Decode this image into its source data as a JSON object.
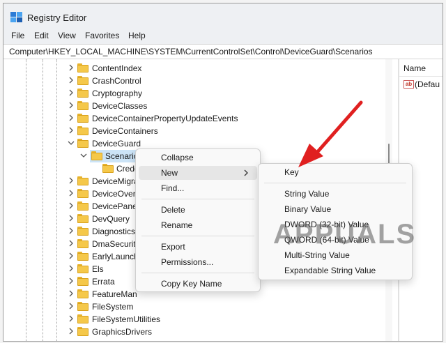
{
  "window": {
    "title": "Registry Editor"
  },
  "menubar": {
    "items": [
      "File",
      "Edit",
      "View",
      "Favorites",
      "Help"
    ]
  },
  "address": {
    "path": "Computer\\HKEY_LOCAL_MACHINE\\SYSTEM\\CurrentControlSet\\Control\\DeviceGuard\\Scenarios"
  },
  "tree": {
    "items": [
      {
        "label": "ContentIndex",
        "state": "collapsed"
      },
      {
        "label": "CrashControl",
        "state": "collapsed"
      },
      {
        "label": "Cryptography",
        "state": "collapsed"
      },
      {
        "label": "DeviceClasses",
        "state": "collapsed"
      },
      {
        "label": "DeviceContainerPropertyUpdateEvents",
        "state": "collapsed"
      },
      {
        "label": "DeviceContainers",
        "state": "collapsed"
      },
      {
        "label": "DeviceGuard",
        "state": "expanded"
      },
      {
        "label": "Scenarios",
        "state": "expanded-selected"
      },
      {
        "label": "Crede",
        "state": "leaf"
      },
      {
        "label": "DeviceMigra",
        "state": "collapsed"
      },
      {
        "label": "DeviceOverri",
        "state": "collapsed"
      },
      {
        "label": "DevicePanel",
        "state": "collapsed"
      },
      {
        "label": "DevQuery",
        "state": "collapsed"
      },
      {
        "label": "Diagnostics",
        "state": "collapsed"
      },
      {
        "label": "DmaSecurit",
        "state": "collapsed"
      },
      {
        "label": "EarlyLaunch",
        "state": "collapsed"
      },
      {
        "label": "Els",
        "state": "collapsed"
      },
      {
        "label": "Errata",
        "state": "collapsed"
      },
      {
        "label": "FeatureMan",
        "state": "collapsed"
      },
      {
        "label": "FileSystem",
        "state": "collapsed"
      },
      {
        "label": "FileSystemUtilities",
        "state": "collapsed"
      },
      {
        "label": "GraphicsDrivers",
        "state": "collapsed"
      }
    ]
  },
  "values_pane": {
    "column_name": "Name",
    "rows": [
      "(Defau"
    ]
  },
  "context_menu": {
    "items": [
      "Collapse",
      "New",
      "Find...",
      "Delete",
      "Rename",
      "Export",
      "Permissions...",
      "Copy Key Name"
    ],
    "hovered": "New"
  },
  "submenu": {
    "items": [
      "Key",
      "String Value",
      "Binary Value",
      "DWORD (32-bit) Value",
      "QWORD (64-bit) Value",
      "Multi-String Value",
      "Expandable String Value"
    ]
  },
  "watermark": {
    "text": "APPUALS"
  },
  "colors": {
    "selection": "#cce4f7",
    "folder": "#f5c84a",
    "annotation_arrow": "#e02020",
    "menu_hover": "#e6e6e6"
  }
}
